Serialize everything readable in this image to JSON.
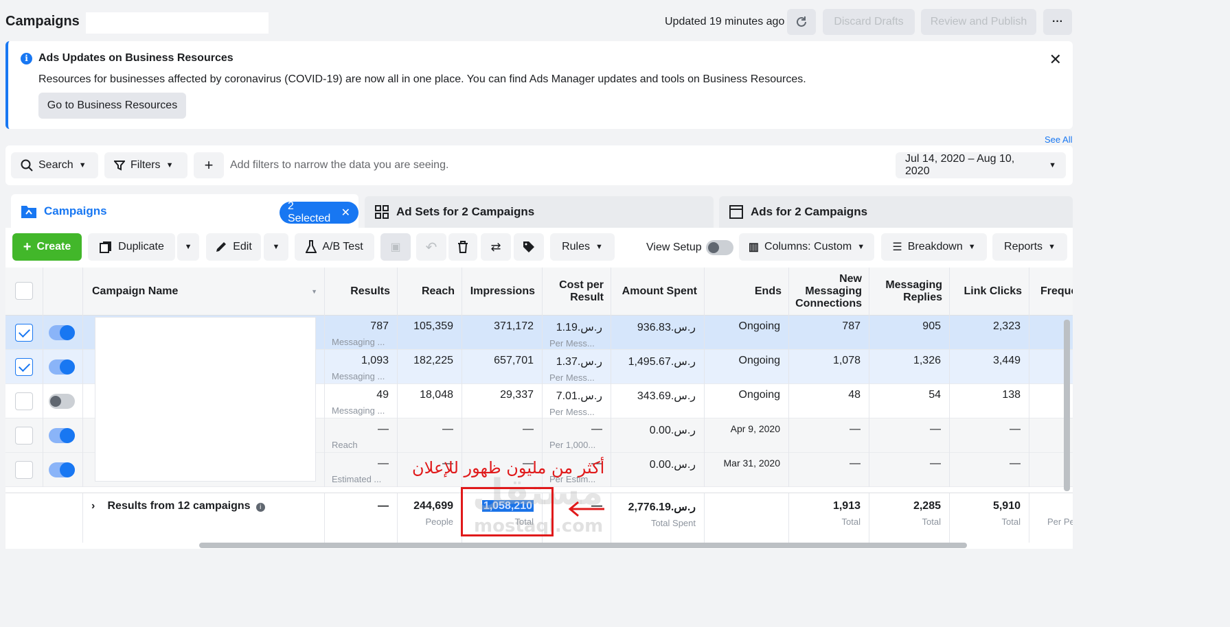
{
  "header": {
    "title": "Campaigns",
    "updated": "Updated 19 minutes ago",
    "discard_label": "Discard Drafts",
    "review_label": "Review and Publish",
    "more_label": "···"
  },
  "banner": {
    "title": "Ads Updates on Business Resources",
    "text": "Resources for businesses affected by coronavirus (COVID-19) are now all in one place. You can find Ads Manager updates and tools on Business Resources.",
    "button": "Go to Business Resources"
  },
  "see_all": "See All",
  "filterbar": {
    "search": "Search",
    "filters": "Filters",
    "hint": "Add filters to narrow the data you are seeing.",
    "date_range": "Jul 14, 2020 – Aug 10, 2020"
  },
  "tabs": {
    "campaigns": "Campaigns",
    "selected": "2 Selected",
    "adsets": "Ad Sets for 2 Campaigns",
    "ads": "Ads for 2 Campaigns"
  },
  "toolbar": {
    "create": "Create",
    "duplicate": "Duplicate",
    "edit": "Edit",
    "ab_test": "A/B Test",
    "rules": "Rules",
    "view_setup": "View Setup",
    "columns": "Columns: Custom",
    "breakdown": "Breakdown",
    "reports": "Reports"
  },
  "columns": [
    "Campaign Name",
    "Results",
    "Reach",
    "Impressions",
    "Cost per Result",
    "Amount Spent",
    "Ends",
    "New Messaging Connections",
    "Messaging Replies",
    "Link Clicks",
    "Freque"
  ],
  "rows": [
    {
      "checked": true,
      "active": true,
      "results": "787",
      "results_sub": "Messaging ...",
      "reach": "105,359",
      "impressions": "371,172",
      "cost": "1.19.ر.س",
      "cost_sub": "Per Mess...",
      "spent": "936.83.ر.س",
      "ends": "Ongoing",
      "connections": "787",
      "replies": "905",
      "clicks": "2,323"
    },
    {
      "checked": true,
      "active": true,
      "results": "1,093",
      "results_sub": "Messaging ...",
      "reach": "182,225",
      "impressions": "657,701",
      "cost": "1.37.ر.س",
      "cost_sub": "Per Mess...",
      "spent": "1,495.67.ر.س",
      "ends": "Ongoing",
      "connections": "1,078",
      "replies": "1,326",
      "clicks": "3,449"
    },
    {
      "checked": false,
      "active": false,
      "results": "49",
      "results_sub": "Messaging ...",
      "reach": "18,048",
      "impressions": "29,337",
      "cost": "7.01.ر.س",
      "cost_sub": "Per Mess...",
      "spent": "343.69.ر.س",
      "ends": "Ongoing",
      "connections": "48",
      "replies": "54",
      "clicks": "138"
    },
    {
      "checked": false,
      "active": true,
      "results": "—",
      "results_sub": "Reach",
      "reach": "—",
      "impressions": "—",
      "cost": "—",
      "cost_sub": "Per 1,000...",
      "spent": "0.00.ر.س",
      "ends": "Apr 9, 2020",
      "connections": "—",
      "replies": "—",
      "clicks": "—"
    },
    {
      "checked": false,
      "active": true,
      "results": "—",
      "results_sub": "Estimated ...",
      "reach": "—",
      "impressions": "—",
      "cost": "—",
      "cost_sub": "Per Estim...",
      "spent": "0.00.ر.س",
      "ends": "Mar 31, 2020",
      "connections": "—",
      "replies": "—",
      "clicks": "—"
    }
  ],
  "totals": {
    "label": "Results from 12 campaigns",
    "results": "—",
    "reach": "244,699",
    "reach_sub": "People",
    "impressions": "1,058,210",
    "impressions_sub": "Total",
    "cost": "—",
    "spent": "2,776.19.ر.س",
    "spent_sub": "Total Spent",
    "connections": "1,913",
    "connections_sub": "Total",
    "replies": "2,285",
    "replies_sub": "Total",
    "clicks": "5,910",
    "clicks_sub": "Total",
    "freq_sub": "Per Pe"
  },
  "annotation": {
    "text": "أكثر من مليون ظهور للإعلان",
    "color": "#e0191a"
  },
  "watermark": {
    "main": "مستقل",
    "sub": "mostaql.com"
  },
  "colors": {
    "accent": "#1877f2",
    "create": "#42b72a",
    "selected_row": "#d6e6fb"
  }
}
